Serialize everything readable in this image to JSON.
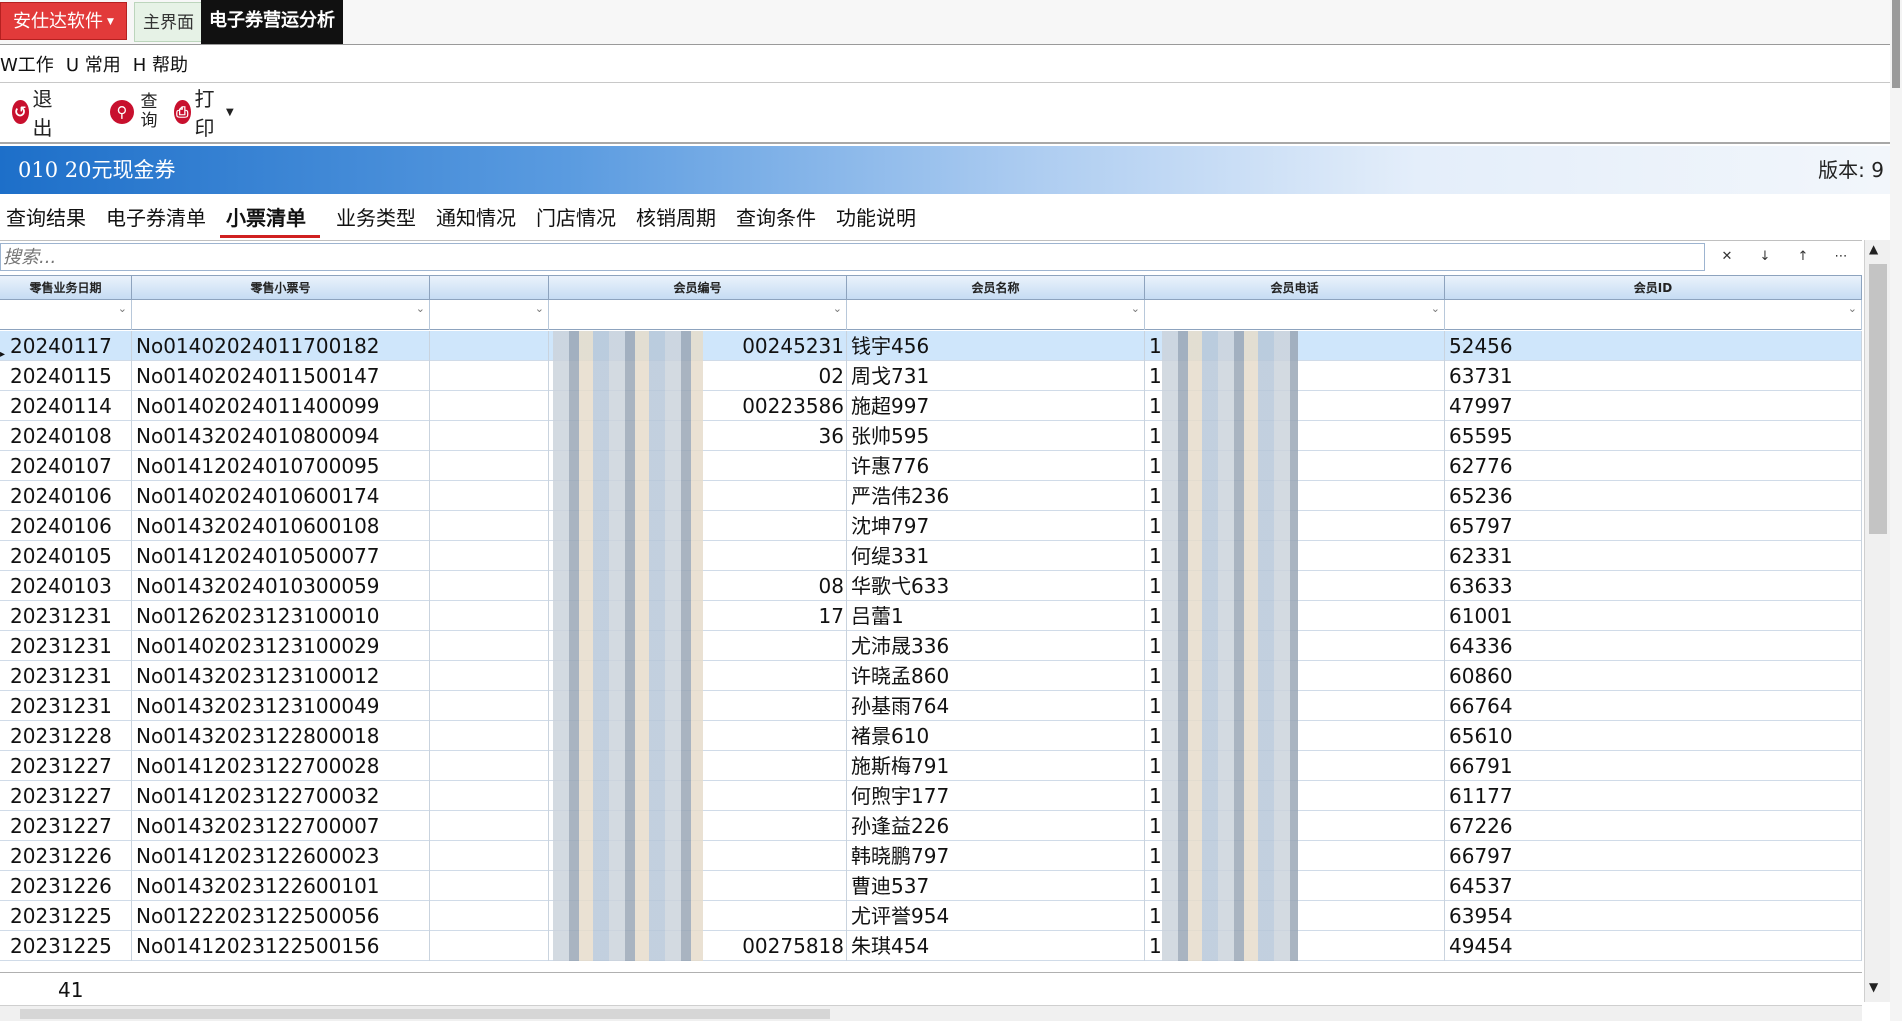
{
  "topbar": {
    "brand": "安仕达软件",
    "home_tab": "主界面",
    "active_tab": "电子券营运分析"
  },
  "menu": [
    "W工作",
    "U 常用",
    "H 帮助"
  ],
  "toolbar": {
    "exit": "退出",
    "query_top": "查",
    "query_bottom": "询",
    "print": "打印"
  },
  "banner": {
    "title": "010  20元现金券",
    "version": "版本: 9"
  },
  "subtabs": [
    "查询结果",
    "电子券清单",
    "小票清单",
    "业务类型",
    "通知情况",
    "门店情况",
    "核销周期",
    "查询条件",
    "功能说明"
  ],
  "search": {
    "placeholder": "搜索..."
  },
  "grid": {
    "columns": [
      "零售业务日期",
      "零售小票号",
      "",
      "会员编号",
      "会员名称",
      "会员电话",
      "会员ID"
    ],
    "rows": [
      {
        "date": "20240117",
        "ticket": "No01402024011700182",
        "member_no": "00245231",
        "name": "钱宇456",
        "phone": "1",
        "id": "52456"
      },
      {
        "date": "20240115",
        "ticket": "No01402024011500147",
        "member_no": "02",
        "name": "周戈731",
        "phone": "1",
        "id": "63731"
      },
      {
        "date": "20240114",
        "ticket": "No01402024011400099",
        "member_no": "00223586",
        "name": "施超997",
        "phone": "1",
        "id": "47997"
      },
      {
        "date": "20240108",
        "ticket": "No01432024010800094",
        "member_no": "36",
        "name": "张帅595",
        "phone": "1",
        "id": "65595"
      },
      {
        "date": "20240107",
        "ticket": "No01412024010700095",
        "member_no": "",
        "name": "许惠776",
        "phone": "1",
        "id": "62776"
      },
      {
        "date": "20240106",
        "ticket": "No01402024010600174",
        "member_no": "",
        "name": "严浩伟236",
        "phone": "1",
        "id": "65236"
      },
      {
        "date": "20240106",
        "ticket": "No01432024010600108",
        "member_no": "",
        "name": "沈坤797",
        "phone": "1",
        "id": "65797"
      },
      {
        "date": "20240105",
        "ticket": "No01412024010500077",
        "member_no": "",
        "name": "何缇331",
        "phone": "1",
        "id": "62331"
      },
      {
        "date": "20240103",
        "ticket": "No01432024010300059",
        "member_no": "08",
        "name": "华歌弋633",
        "phone": "1",
        "id": "63633"
      },
      {
        "date": "20231231",
        "ticket": "No01262023123100010",
        "member_no": "17",
        "name": "吕蕾1",
        "phone": "1",
        "id": "61001"
      },
      {
        "date": "20231231",
        "ticket": "No01402023123100029",
        "member_no": "",
        "name": "尤沛晟336",
        "phone": "1",
        "id": "64336"
      },
      {
        "date": "20231231",
        "ticket": "No01432023123100012",
        "member_no": "",
        "name": "许晓孟860",
        "phone": "1",
        "id": "60860"
      },
      {
        "date": "20231231",
        "ticket": "No01432023123100049",
        "member_no": "",
        "name": "孙基雨764",
        "phone": "1",
        "id": "66764"
      },
      {
        "date": "20231228",
        "ticket": "No01432023122800018",
        "member_no": "",
        "name": "褚景610",
        "phone": "1",
        "id": "65610"
      },
      {
        "date": "20231227",
        "ticket": "No01412023122700028",
        "member_no": "",
        "name": "施斯梅791",
        "phone": "1",
        "id": "66791"
      },
      {
        "date": "20231227",
        "ticket": "No01412023122700032",
        "member_no": "",
        "name": "何煦宇177",
        "phone": "1",
        "id": "61177"
      },
      {
        "date": "20231227",
        "ticket": "No01432023122700007",
        "member_no": "",
        "name": "孙逢益226",
        "phone": "1",
        "id": "67226"
      },
      {
        "date": "20231226",
        "ticket": "No01412023122600023",
        "member_no": "",
        "name": "韩晓鹏797",
        "phone": "1",
        "id": "66797"
      },
      {
        "date": "20231226",
        "ticket": "No01432023122600101",
        "member_no": "",
        "name": "曹迪537",
        "phone": "1",
        "id": "64537"
      },
      {
        "date": "20231225",
        "ticket": "No01222023122500056",
        "member_no": "",
        "name": "尤评誉954",
        "phone": "1",
        "id": "63954"
      },
      {
        "date": "20231225",
        "ticket": "No01412023122500156",
        "member_no": "00275818",
        "name": "朱琪454",
        "phone": "1",
        "id": "49454"
      }
    ]
  },
  "footer": {
    "count": "41"
  }
}
